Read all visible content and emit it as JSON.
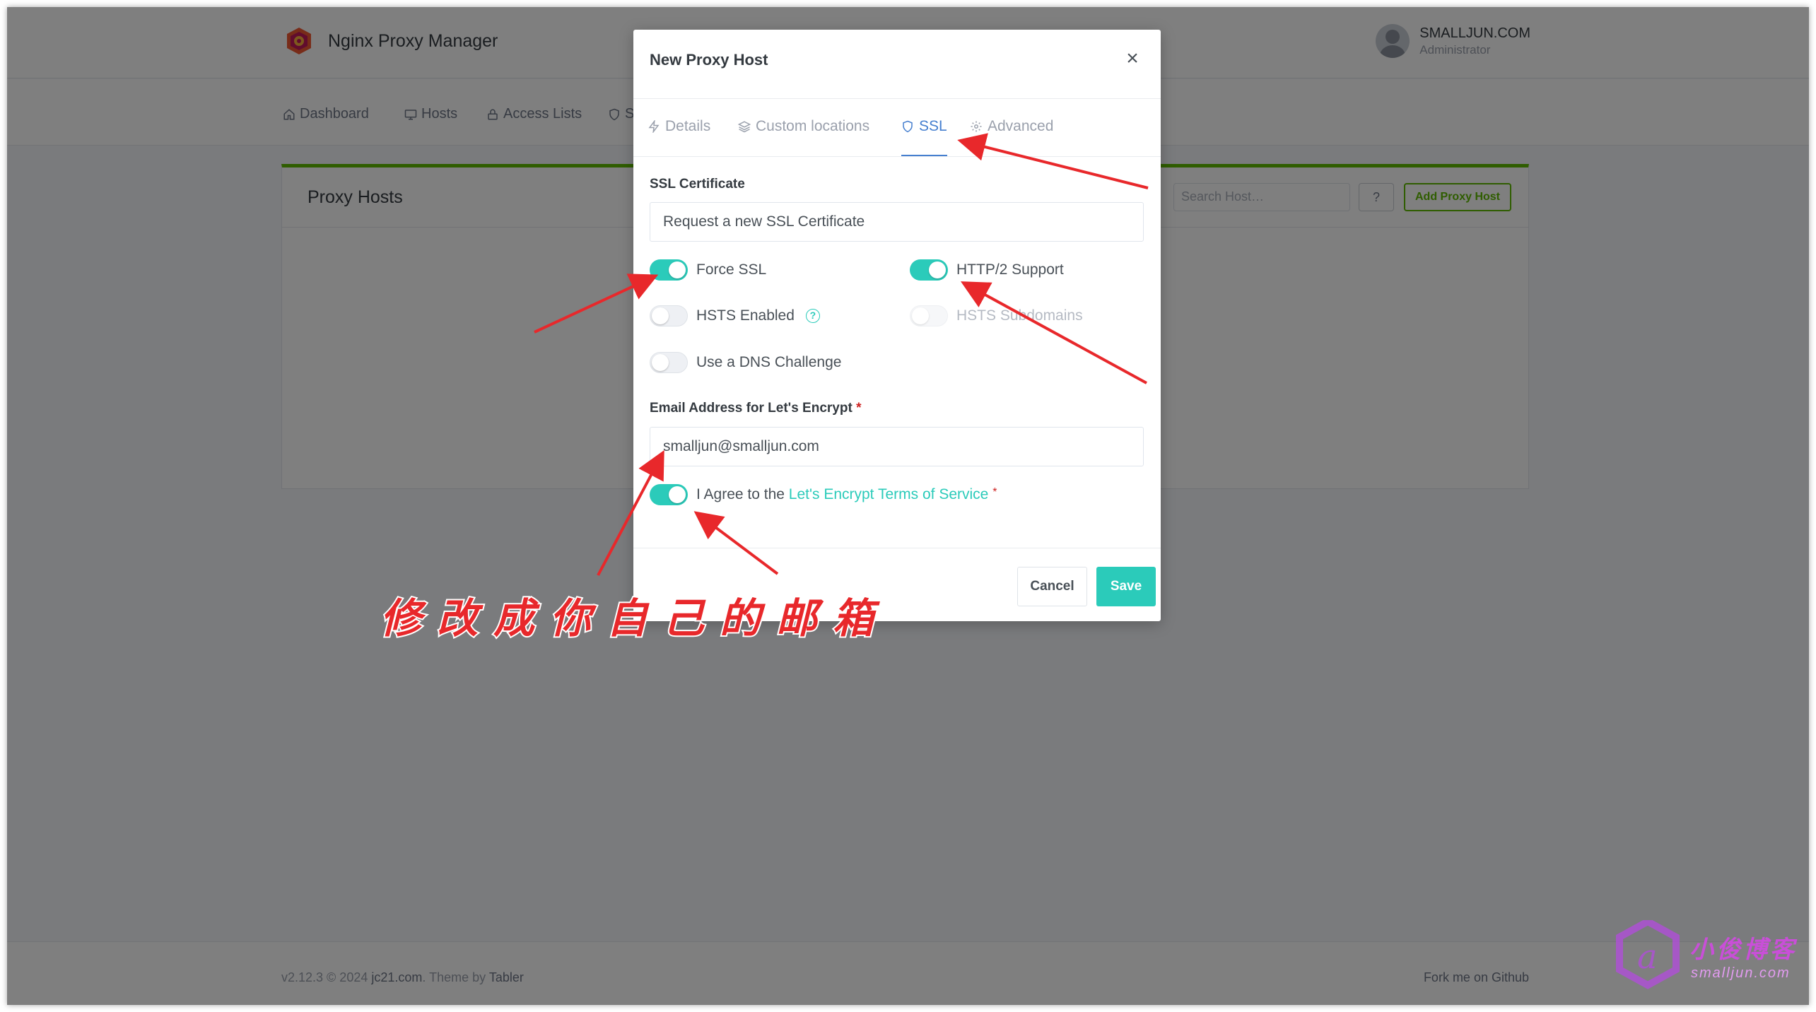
{
  "app": {
    "name": "Nginx Proxy Manager",
    "user_name": "SMALLJUN.COM",
    "user_role": "Administrator"
  },
  "nav": {
    "items": [
      {
        "label": "Dashboard",
        "icon": "home-icon"
      },
      {
        "label": "Hosts",
        "icon": "monitor-icon"
      },
      {
        "label": "Access Lists",
        "icon": "lock-icon"
      },
      {
        "label": "SSL",
        "icon": "shield-icon"
      }
    ]
  },
  "page": {
    "title": "Proxy Hosts",
    "search_placeholder": "Search Host…",
    "help_label": "?",
    "add_button": "Add Proxy Host"
  },
  "footer": {
    "version": "v2.12.3 © 2024",
    "company": "jc21.com",
    "theme_prefix": ". Theme by",
    "theme": "Tabler",
    "fork": "Fork me on Github"
  },
  "modal": {
    "title": "New Proxy Host",
    "close": "×",
    "tabs": [
      {
        "label": "Details",
        "icon": "zap-icon",
        "active": false
      },
      {
        "label": "Custom locations",
        "icon": "layers-icon",
        "active": false
      },
      {
        "label": "SSL",
        "icon": "shield-icon",
        "active": true
      },
      {
        "label": "Advanced",
        "icon": "gear-icon",
        "active": false
      }
    ],
    "ssl_certificate_label": "SSL Certificate",
    "ssl_certificate_value": "Request a new SSL Certificate",
    "toggles": {
      "force_ssl": {
        "label": "Force SSL",
        "on": true
      },
      "http2": {
        "label": "HTTP/2 Support",
        "on": true
      },
      "hsts": {
        "label": "HSTS Enabled",
        "on": false
      },
      "hsts_subdomains": {
        "label": "HSTS Subdomains",
        "on": false,
        "disabled": true
      },
      "dns_challenge": {
        "label": "Use a DNS Challenge",
        "on": false
      }
    },
    "email_label": "Email Address for Let's Encrypt",
    "email_required": "*",
    "email_value": "smalljun@smalljun.com",
    "agree_prefix": "I Agree to the",
    "agree_link": "Let's Encrypt Terms of Service",
    "agree_required": "*",
    "agree_on": true,
    "cancel": "Cancel",
    "save": "Save"
  },
  "annotation": {
    "caption": "修改成你自己的邮箱",
    "color": "#e8282b"
  },
  "watermark": {
    "title": "小俊博客",
    "url": "smalljun.com"
  },
  "colors": {
    "accent": "#2bcbba",
    "tab_active": "#467fcf",
    "card_top": "#5eba00",
    "required": "#cd201f"
  }
}
